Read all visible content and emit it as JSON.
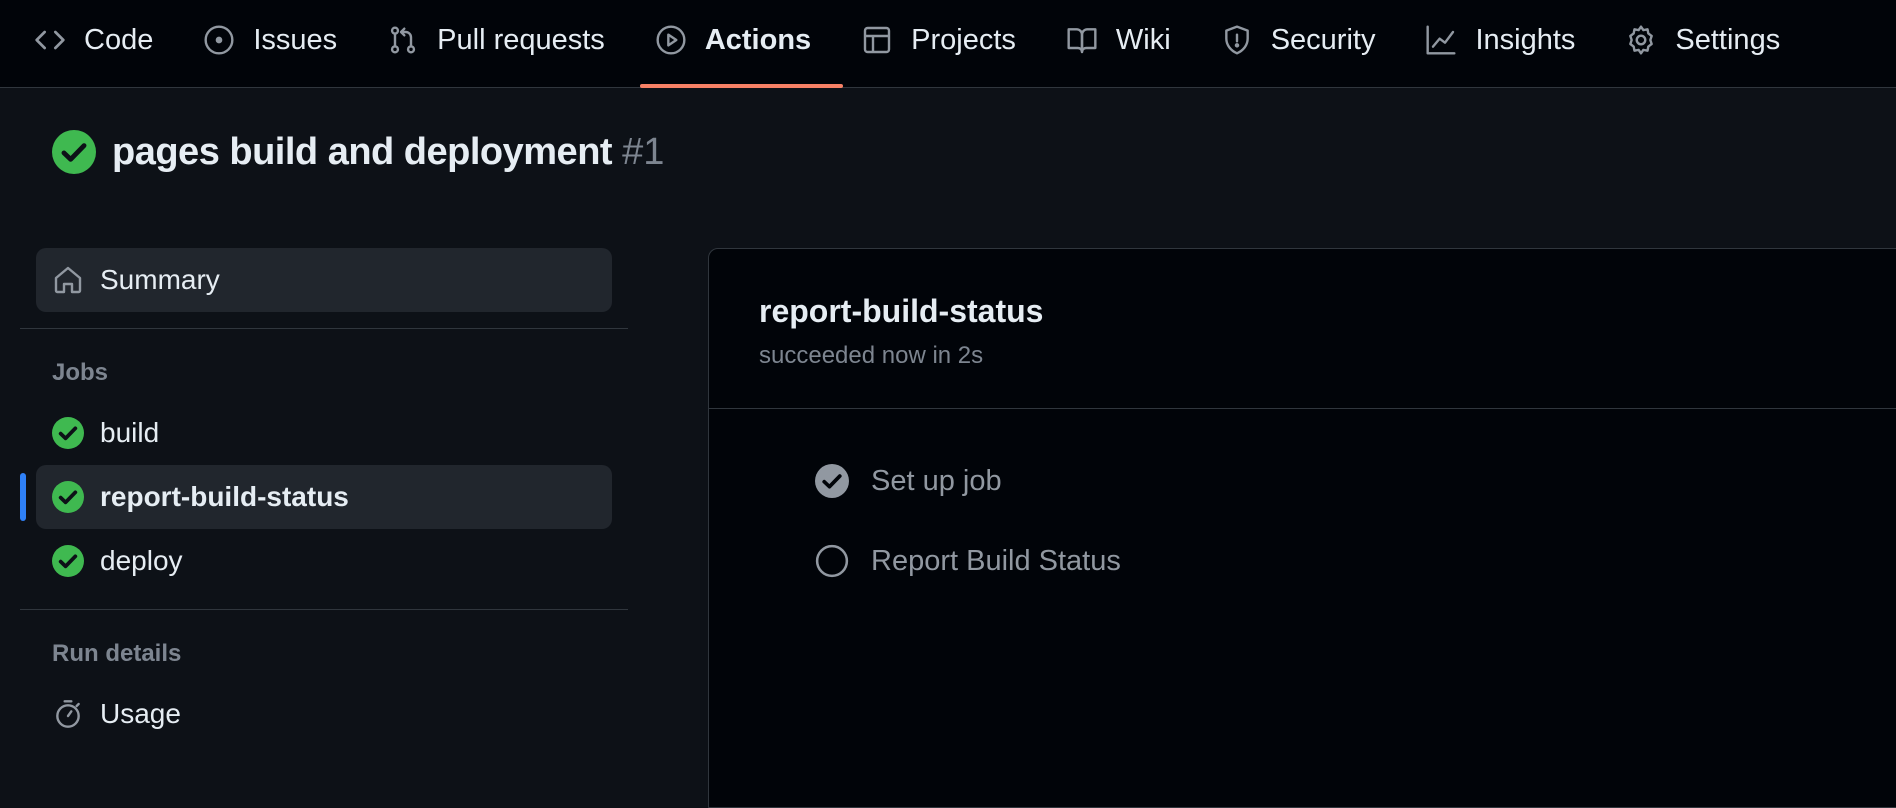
{
  "nav": {
    "tabs": [
      {
        "label": "Code",
        "icon": "code-icon"
      },
      {
        "label": "Issues",
        "icon": "issue-opened-icon"
      },
      {
        "label": "Pull requests",
        "icon": "git-pull-request-icon"
      },
      {
        "label": "Actions",
        "icon": "play-icon",
        "active": true
      },
      {
        "label": "Projects",
        "icon": "table-icon"
      },
      {
        "label": "Wiki",
        "icon": "book-icon"
      },
      {
        "label": "Security",
        "icon": "shield-icon"
      },
      {
        "label": "Insights",
        "icon": "graph-icon"
      },
      {
        "label": "Settings",
        "icon": "gear-icon"
      }
    ]
  },
  "run": {
    "title": "pages build and deployment",
    "number": "#1",
    "status": "success"
  },
  "sidebar": {
    "summary_label": "Summary",
    "jobs_heading": "Jobs",
    "jobs": [
      {
        "label": "build",
        "status": "success"
      },
      {
        "label": "report-build-status",
        "status": "success",
        "selected": true
      },
      {
        "label": "deploy",
        "status": "success"
      }
    ],
    "run_details_heading": "Run details",
    "usage_label": "Usage"
  },
  "job": {
    "title": "report-build-status",
    "subtitle": "succeeded now in 2s",
    "steps": [
      {
        "label": "Set up job",
        "status": "completed"
      },
      {
        "label": "Report Build Status",
        "status": "pending"
      }
    ]
  },
  "colors": {
    "background": "#0d1117",
    "nav_background": "#010409",
    "active_tab_underline": "#f78166",
    "success": "#3fb950",
    "selected_indicator": "#2f81f7",
    "muted_text": "#7d8590"
  }
}
